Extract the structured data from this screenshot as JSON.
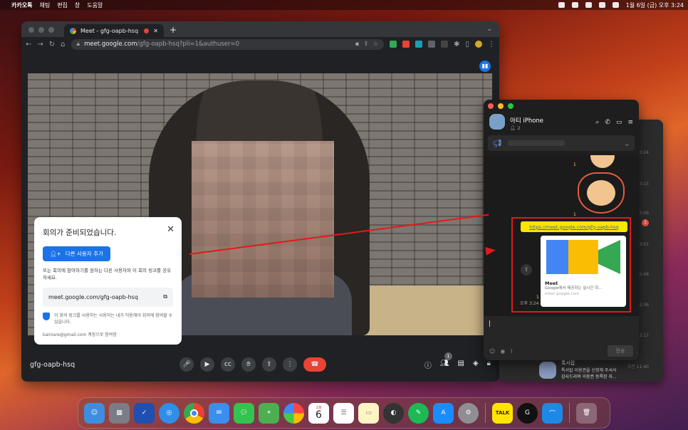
{
  "menubar": {
    "app": "카카오톡",
    "menus": [
      "채팅",
      "편집",
      "창",
      "도움말"
    ],
    "datetime": "1월 6일 (금) 오후 3:24"
  },
  "browser": {
    "tab_title": "Meet - gfg-oapb-hsq",
    "url_host": "meet.google.com",
    "url_path": "/gfg-oapb-hsq?pli=1&authuser=0"
  },
  "meet": {
    "meeting_name": "gfg-oapb-hsq",
    "participants_badge": "1",
    "popup": {
      "title": "회의가 준비되었습니다.",
      "add_button": "다른 사용자 추가",
      "share_text": "또는 회의에 참여하기를 원하는 다른 사용자와 이 회의 링크를 공유하세요.",
      "link": "meet.google.com/gfg-oapb-hsq",
      "note": "이 회의 링크를 사용하는 사용자는 내가 허용해야 회의에 참여할 수 있습니다.",
      "joined_as": "kairosre@gmail.com 계정으로 참여함"
    }
  },
  "kakao_chat": {
    "title": "아티 iPhone",
    "members": "2",
    "unread_marks": [
      "1",
      "1",
      "1"
    ],
    "link_message": "https://meet.google.com/gfg-oapb-hsq",
    "preview": {
      "title": "Meet",
      "desc": "Google에서 제공하는 실시간 회...",
      "domain": "meet.google.com"
    },
    "time": "오후 3:24",
    "send_label": "전송"
  },
  "kakao_list": {
    "times": [
      "3:24",
      "3:15",
      "3:06",
      "3:01",
      "2:48",
      "2:36",
      "2:17",
      "오전 11:40"
    ],
    "badge": "1",
    "last_item": {
      "name": "톡서랍",
      "line1": "톡서랍 이용권을 신청해 주셔서",
      "line2": "감사드리며 이용권 등록된 자..."
    }
  },
  "dock": {
    "calendar_month": "1월",
    "calendar_day": "6",
    "talk_label": "TALK"
  },
  "colors": {
    "meet_blue": "#1a73e8",
    "end_call": "#ea4335",
    "kakao_yellow": "#fee500",
    "annotation_red": "#e01a1a"
  }
}
